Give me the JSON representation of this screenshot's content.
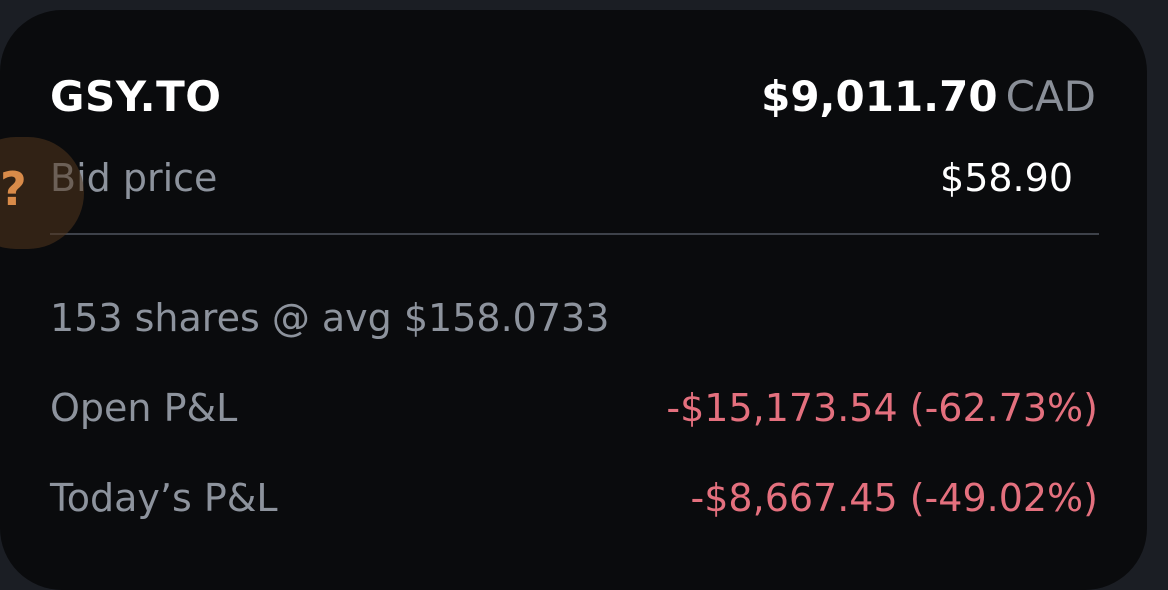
{
  "position": {
    "ticker": "GSY.TO",
    "market_value": "$9,011.70",
    "currency": "CAD",
    "bid_label": "Bid price",
    "bid_price": "$58.90",
    "shares_summary": "153 shares @ avg $158.0733",
    "open_pnl_label": "Open P&L",
    "open_pnl_value": "-$15,173.54 (-62.73%)",
    "today_pnl_label": "Today’s P&L",
    "today_pnl_value": "-$8,667.45 (-49.02%)"
  },
  "help": {
    "icon": "question-mark",
    "glyph": "?"
  },
  "colors": {
    "negative": "#e4707e",
    "help_accent": "#d98b49"
  }
}
